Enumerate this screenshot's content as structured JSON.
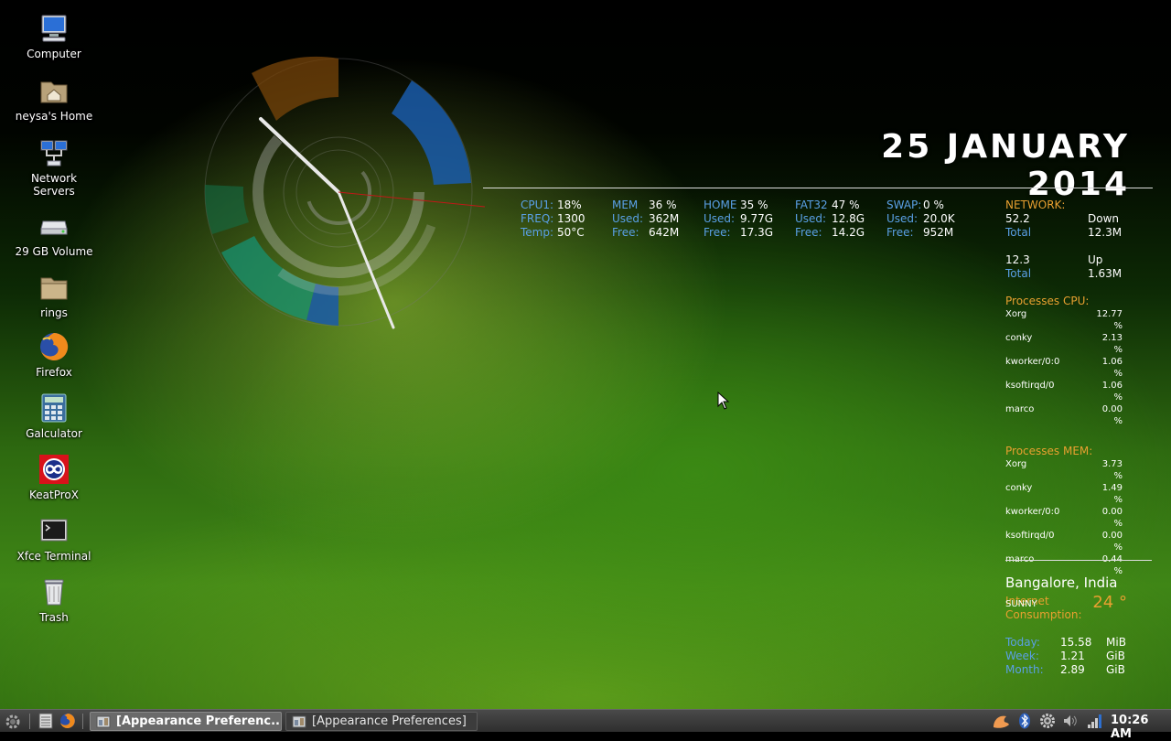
{
  "desktop": {
    "icons": [
      {
        "label": "Computer"
      },
      {
        "label": "neysa's Home"
      },
      {
        "label": "Network\nServers"
      },
      {
        "label": "29 GB Volume"
      },
      {
        "label": "rings"
      },
      {
        "label": "Firefox"
      },
      {
        "label": "Galculator"
      },
      {
        "label": "KeatProX"
      },
      {
        "label": "Xfce Terminal"
      },
      {
        "label": "Trash"
      }
    ]
  },
  "conky": {
    "date": "25 JANUARY 2014",
    "cpu": {
      "cpu1_label": "CPU1:",
      "cpu1_value": "18%",
      "freq_label": "FREQ:",
      "freq_value": "1300",
      "temp_label": "Temp:",
      "temp_value": "50°C"
    },
    "mem": {
      "label": "MEM",
      "value": "36 %",
      "used_label": "Used:",
      "used_value": "362M",
      "free_label": "Free:",
      "free_value": "642M"
    },
    "home": {
      "label": "HOME",
      "value": "35 %",
      "used_label": "Used:",
      "used_value": "9.77G",
      "free_label": "Free:",
      "free_value": "17.3G"
    },
    "fat32": {
      "label": "FAT32",
      "value": "47 %",
      "used_label": "Used:",
      "used_value": "12.8G",
      "free_label": "Free:",
      "free_value": "14.2G"
    },
    "swap": {
      "label": "SWAP:",
      "value": "0 %",
      "used_label": "Used:",
      "used_value": "20.0K",
      "free_label": "Free:",
      "free_value": "952M"
    },
    "network": {
      "title": "NETWORK:",
      "down_rate": "52.2",
      "down_label": "Down",
      "down_total_label": "Total",
      "down_total": "12.3M",
      "up_rate": "12.3",
      "up_label": "Up",
      "up_total_label": "Total",
      "up_total": "1.63M"
    },
    "processes_cpu": {
      "title": "Processes CPU:",
      "rows": [
        {
          "name": "Xorg",
          "value": "12.77 %"
        },
        {
          "name": "conky",
          "value": "2.13 %"
        },
        {
          "name": "kworker/0:0",
          "value": "1.06 %"
        },
        {
          "name": "ksoftirqd/0",
          "value": "1.06 %"
        },
        {
          "name": "marco",
          "value": "0.00 %"
        }
      ]
    },
    "processes_mem": {
      "title": "Processes MEM:",
      "rows": [
        {
          "name": "Xorg",
          "value": "3.73 %"
        },
        {
          "name": "conky",
          "value": "1.49 %"
        },
        {
          "name": "kworker/0:0",
          "value": "0.00 %"
        },
        {
          "name": "ksoftirqd/0",
          "value": "0.00 %"
        },
        {
          "name": "marco",
          "value": "0.44 %"
        }
      ]
    },
    "internet": {
      "title_line1": "Internet",
      "title_line2": "Consumption:",
      "rows": [
        {
          "label": "Today:",
          "value": "15.58",
          "unit": "MiB"
        },
        {
          "label": "Week:",
          "value": "1.21",
          "unit": "GiB"
        },
        {
          "label": "Month:",
          "value": "2.89",
          "unit": "GiB"
        }
      ]
    },
    "weather": {
      "city": "Bangalore, India",
      "condition": "SUNNY",
      "temperature": "24 °"
    }
  },
  "taskbar": {
    "tasks": [
      {
        "label": "[Appearance Preferenc..."
      },
      {
        "label": "[Appearance Preferences]"
      }
    ],
    "clock": "10:26 AM"
  },
  "colors": {
    "accent_orange": "#e8a030",
    "label_blue": "#5aa0e6"
  }
}
